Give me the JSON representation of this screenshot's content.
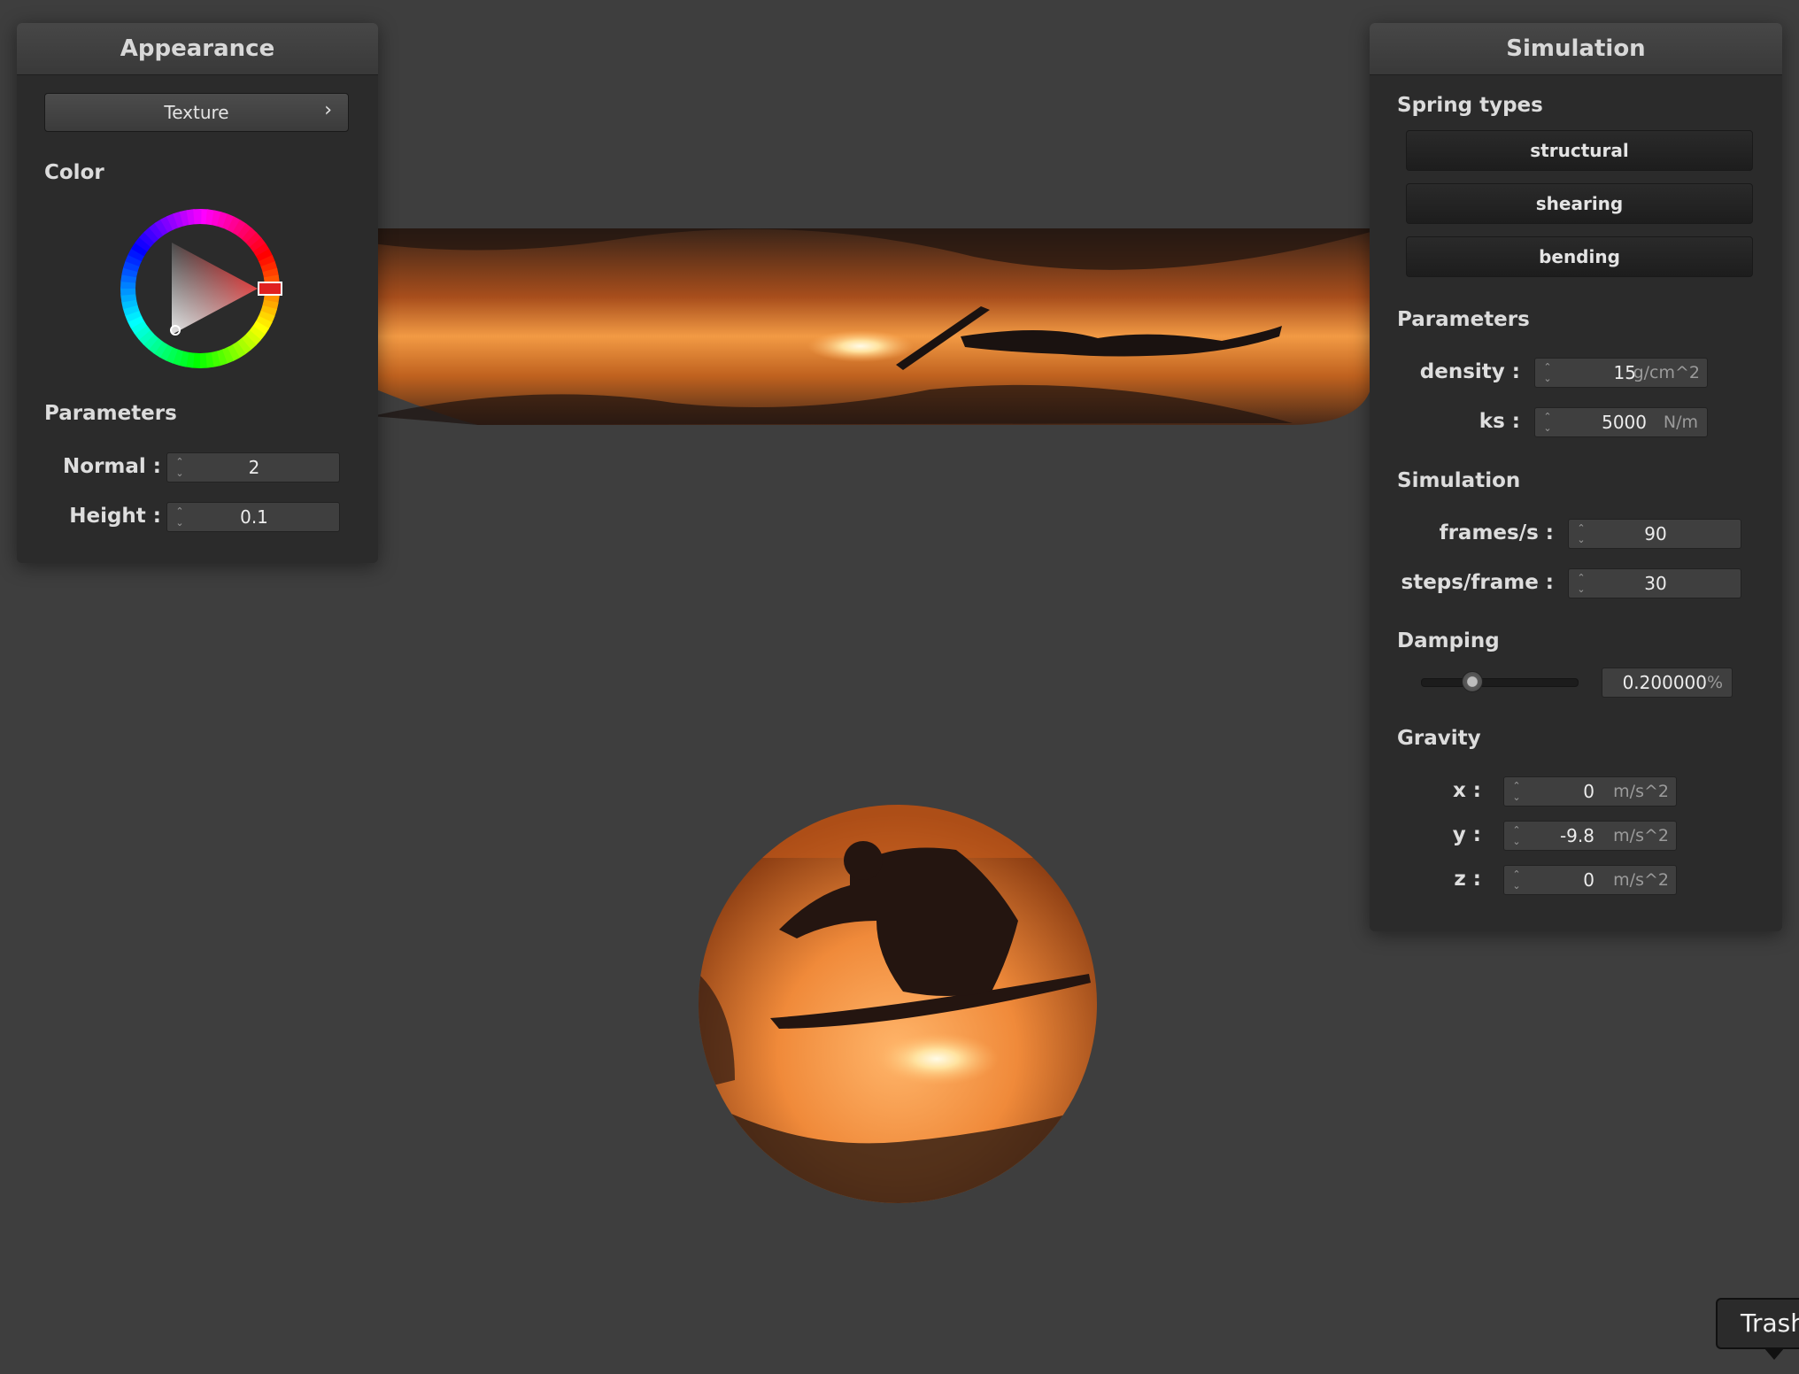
{
  "colors": {
    "background": "#3e3e3e",
    "panel": "#2b2b2b",
    "accent_picker": "#e02020",
    "texture_warm": "#f08a3a"
  },
  "appearance": {
    "title": "Appearance",
    "texture_button": {
      "label": "Texture",
      "icon": "chevron-right-icon",
      "glyph": "›"
    },
    "color_label": "Color",
    "parameters_label": "Parameters",
    "normal": {
      "label": "Normal :",
      "value": "2"
    },
    "height": {
      "label": "Height :",
      "value": "0.1"
    }
  },
  "simulation": {
    "title": "Simulation",
    "spring_types_label": "Spring types",
    "spring_types": [
      "structural",
      "shearing",
      "bending"
    ],
    "parameters_label": "Parameters",
    "density": {
      "label": "density :",
      "value": "15",
      "unit": "g/cm^2"
    },
    "ks": {
      "label": "ks :",
      "value": "5000",
      "unit": "N/m"
    },
    "simulation_label": "Simulation",
    "frames": {
      "label": "frames/s :",
      "value": "90"
    },
    "steps": {
      "label": "steps/frame :",
      "value": "30"
    },
    "damping_label": "Damping",
    "damping": {
      "value": "0.200000",
      "unit": "%",
      "slider_fraction": 0.2
    },
    "gravity_label": "Gravity",
    "gravity": [
      {
        "label": "x :",
        "value": "0",
        "unit": "m/s^2"
      },
      {
        "label": "y :",
        "value": "-9.8",
        "unit": "m/s^2"
      },
      {
        "label": "z :",
        "value": "0",
        "unit": "m/s^2"
      }
    ]
  },
  "scene": {
    "cloth_texture": "snowboarder-sunset-silhouette",
    "sphere_texture": "snowboarder-sunset-silhouette"
  },
  "tooltip": {
    "text": "Trash"
  }
}
